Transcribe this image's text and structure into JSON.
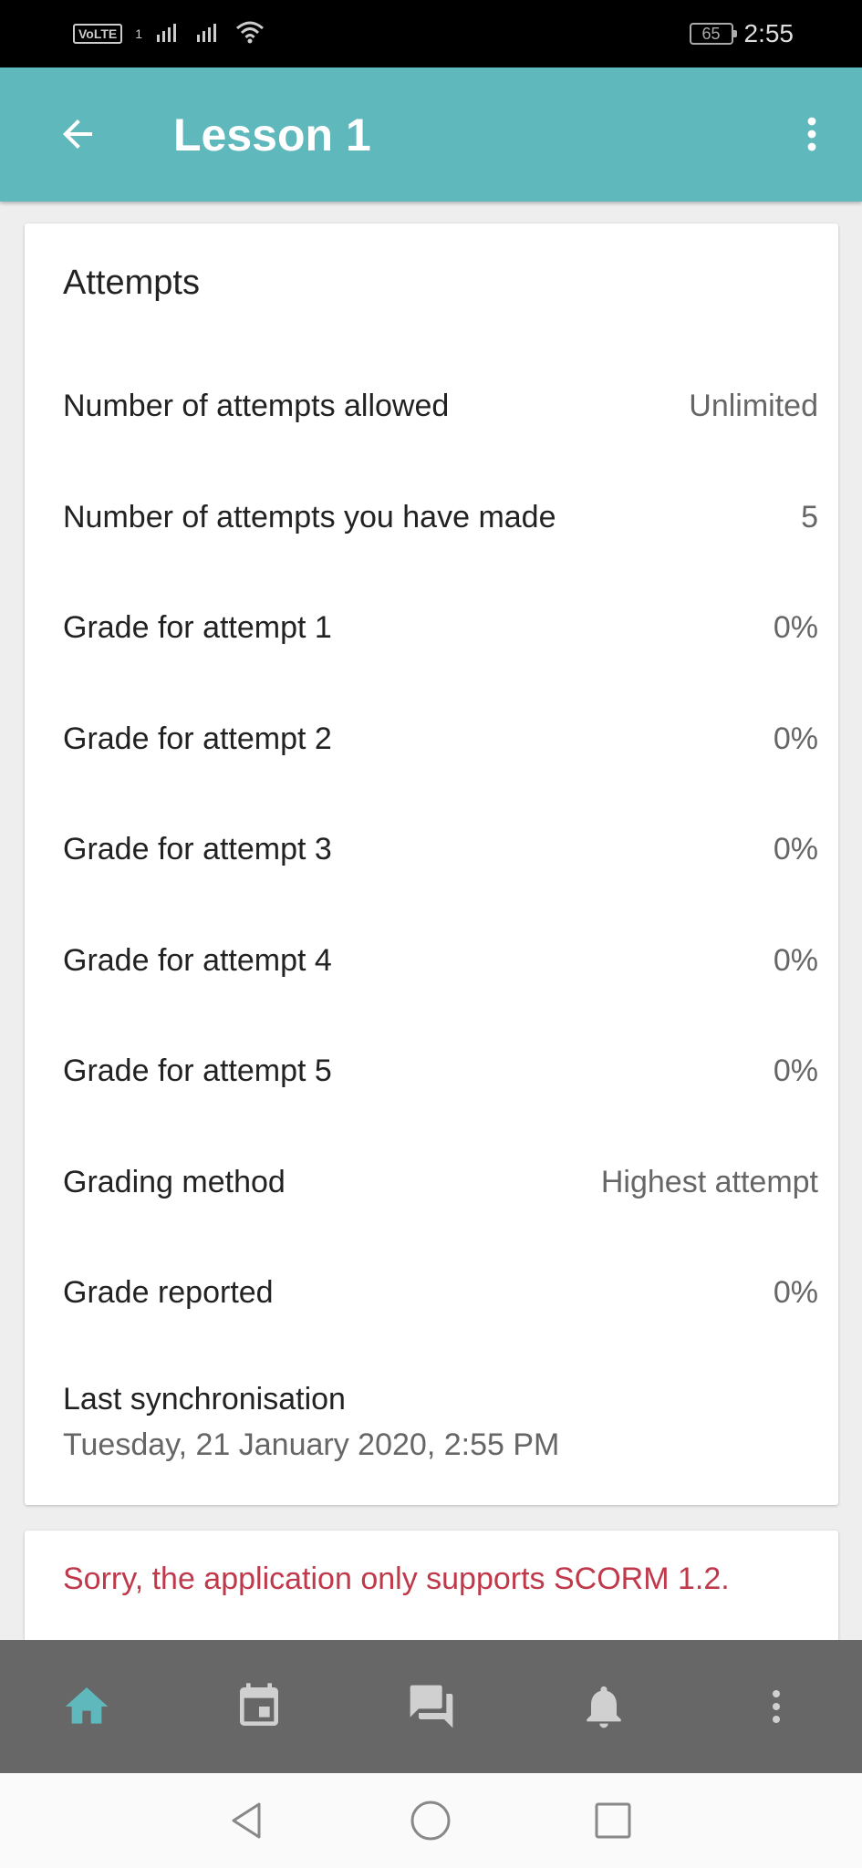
{
  "status_bar": {
    "volte": "VoLTE",
    "sim": "1",
    "battery": "65",
    "time": "2:55"
  },
  "app_bar": {
    "title": "Lesson 1",
    "back_icon": "arrow-back-icon",
    "menu_icon": "more-vert-icon"
  },
  "attempts_card": {
    "title": "Attempts",
    "rows": [
      {
        "label": "Number of attempts allowed",
        "value": "Unlimited"
      },
      {
        "label": "Number of attempts you have made",
        "value": "5"
      },
      {
        "label": "Grade for attempt 1",
        "value": "0%"
      },
      {
        "label": "Grade for attempt 2",
        "value": "0%"
      },
      {
        "label": "Grade for attempt 3",
        "value": "0%"
      },
      {
        "label": "Grade for attempt 4",
        "value": "0%"
      },
      {
        "label": "Grade for attempt 5",
        "value": "0%"
      },
      {
        "label": "Grading method",
        "value": "Highest attempt"
      },
      {
        "label": "Grade reported",
        "value": "0%"
      }
    ],
    "sync_label": "Last synchronisation",
    "sync_value": "Tuesday, 21 January 2020, 2:55 PM"
  },
  "error_card": {
    "message": "Sorry, the application only supports SCORM 1.2."
  },
  "bottom_nav": {
    "items": [
      {
        "icon": "home-icon",
        "active": true
      },
      {
        "icon": "calendar-icon",
        "active": false
      },
      {
        "icon": "messages-icon",
        "active": false
      },
      {
        "icon": "notifications-icon",
        "active": false
      },
      {
        "icon": "more-vert-icon",
        "active": false
      }
    ]
  },
  "colors": {
    "accent": "#5fb8bc",
    "error": "#c0394b",
    "nav_bg": "#676767",
    "nav_inactive": "#d0d0d0"
  }
}
